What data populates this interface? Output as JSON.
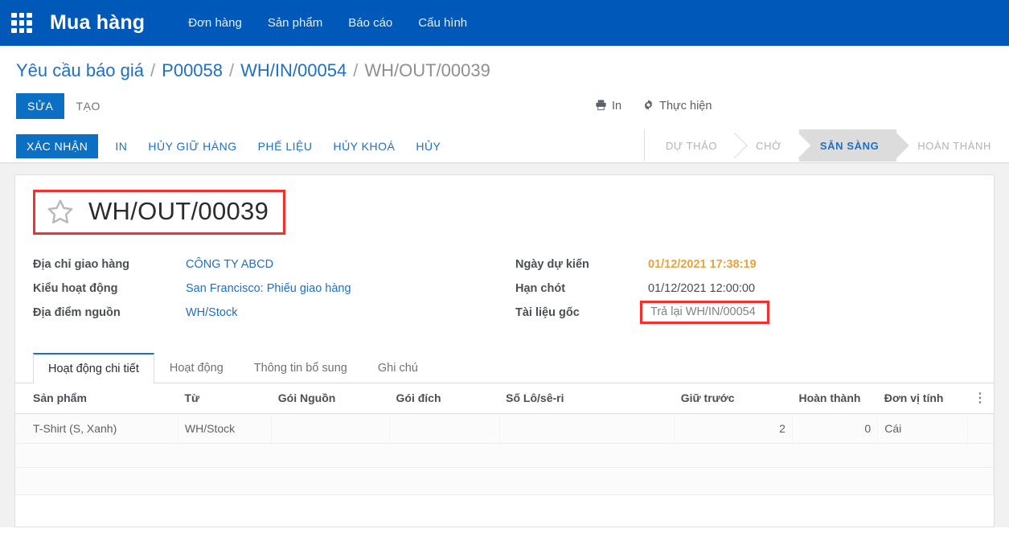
{
  "navbar": {
    "apps_icon": "apps-grid-icon",
    "brand": "Mua hàng",
    "links": [
      {
        "label": "Đơn hàng"
      },
      {
        "label": "Sản phẩm"
      },
      {
        "label": "Báo cáo"
      },
      {
        "label": "Cấu hình"
      }
    ],
    "background": "#0059b8"
  },
  "breadcrumb": [
    {
      "label": "Yêu cầu báo giá",
      "active": false
    },
    {
      "label": "P00058",
      "active": false
    },
    {
      "label": "WH/IN/00054",
      "active": false
    },
    {
      "label": "WH/OUT/00039",
      "active": true
    }
  ],
  "breadcrumb_sep": "/",
  "record_actions": {
    "edit_label": "SỬA",
    "create_label": "TẠO",
    "print_label": "In",
    "print_icon": "printer-icon",
    "action_label": "Thực hiện",
    "action_icon": "gear-icon"
  },
  "statusbar": {
    "buttons": [
      {
        "label": "XÁC NHẬN",
        "primary": true
      },
      {
        "label": "IN",
        "primary": false
      },
      {
        "label": "HỦY GIỮ HÀNG",
        "primary": false
      },
      {
        "label": "PHẾ LIỆU",
        "primary": false
      },
      {
        "label": "HỦY KHOÁ",
        "primary": false
      },
      {
        "label": "HỦY",
        "primary": false
      }
    ],
    "pipeline": [
      {
        "label": "DỰ THẢO",
        "active": false
      },
      {
        "label": "CHỜ",
        "active": false
      },
      {
        "label": "SẴN SÀNG",
        "active": true
      },
      {
        "label": "HOÀN THÀNH",
        "active": false
      }
    ]
  },
  "record": {
    "star_icon": "star-outline-icon",
    "title": "WH/OUT/00039",
    "left_fields": [
      {
        "label": "Địa chỉ giao hàng",
        "value": "CÔNG TY ABCD"
      },
      {
        "label": "Kiểu hoạt động",
        "value": "San Francisco: Phiếu giao hàng"
      },
      {
        "label": "Địa điểm nguồn",
        "value": "WH/Stock"
      }
    ],
    "right_fields": [
      {
        "label": "Ngày dự kiến",
        "value": "01/12/2021 17:38:19"
      },
      {
        "label": "Hạn chót",
        "value": "01/12/2021 12:00:00"
      },
      {
        "label": "Tài liệu gốc",
        "value": "Trả lại WH/IN/00054"
      }
    ]
  },
  "tabs": [
    {
      "label": "Hoạt động chi tiết",
      "active": true
    },
    {
      "label": "Hoạt động",
      "active": false
    },
    {
      "label": "Thông tin bổ sung",
      "active": false
    },
    {
      "label": "Ghi chú",
      "active": false
    }
  ],
  "table": {
    "columns": [
      "Sản phẩm",
      "Từ",
      "Gói Nguồn",
      "Gói đích",
      "Số Lô/sê-ri",
      "Giữ trước",
      "Hoàn thành",
      "Đơn vị tính"
    ],
    "options_icon": "vertical-dots-icon",
    "rows": [
      {
        "product": "T-Shirt (S, Xanh)",
        "from": "WH/Stock",
        "source_package": "",
        "dest_package": "",
        "lot_serial": "",
        "reserved": "2",
        "done": "0",
        "uom": "Cái"
      }
    ]
  },
  "annotations": {
    "highlight_color": "#f33030",
    "title_box": "WH/OUT/00039",
    "source_doc_box": "Trả lại WH/IN/00054"
  }
}
